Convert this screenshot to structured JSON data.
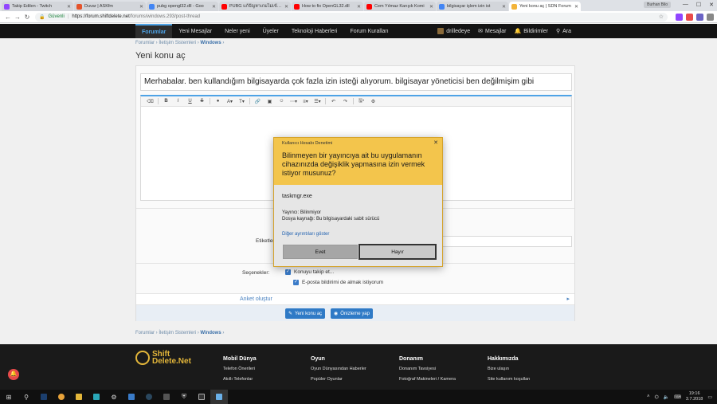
{
  "browser": {
    "tabs": [
      {
        "title": "Takip Edilen - Twitch",
        "color": "#9146ff",
        "active": false
      },
      {
        "title": "Duvar | ASKfm",
        "color": "#e5532b",
        "active": false
      },
      {
        "title": "pubg opengl32.dll - Goo",
        "color": "#4285f4",
        "active": false
      },
      {
        "title": "PUBG แก้ปัญหาเกมไม่เข้าข้อมูล",
        "color": "#ff0000",
        "active": false
      },
      {
        "title": "How to fix OpenGL32.dll",
        "color": "#ff0000",
        "active": false
      },
      {
        "title": "Cem Yılmaz Karışık Komi",
        "color": "#ff0000",
        "active": false
      },
      {
        "title": "bilgisayar işlem izin ist",
        "color": "#4285f4",
        "active": false
      },
      {
        "title": "Yeni konu aç | SDN Forum",
        "color": "#f3b43a",
        "active": true
      }
    ],
    "profile": "Burhan Bilo",
    "secure_label": "Güvenli",
    "url_host": "https://forum.shiftdelete.net",
    "url_path": "/forums/windows.293/post-thread"
  },
  "sitenav": {
    "items": [
      "Forumlar",
      "Yeni Mesajlar",
      "Neler yeni",
      "Üyeler",
      "Teknoloji Haberleri",
      "Forum Kuralları"
    ],
    "user": "drilledeye",
    "messages": "Mesajlar",
    "alerts": "Bildirimler",
    "search": "Ara"
  },
  "breadcrumb": [
    "Forumlar",
    "İletişim Sistemleri",
    "Windows"
  ],
  "page_title": "Yeni konu aç",
  "form": {
    "title_value": "Merhabalar. ben kullandığım bilgisayarda çok fazla izin isteği alıyorum. bilgisayar yöneticisi ben değilmişim gibi",
    "tags_label": "Etiketler",
    "options_label": "Seçenekler:",
    "watch_label": "Konuyu takip et...",
    "email_label": "E-posta bildirimi de almak istiyorum",
    "poll_label": "Anket oluştur",
    "submit_label": "Yeni konu aç",
    "preview_label": "Önizleme yap"
  },
  "footer": {
    "logo_line1": "Shift",
    "logo_line2": "Delete.Net",
    "columns": [
      {
        "heading": "Mobil Dünya",
        "items": [
          "Telefon Önerileri",
          "Akıllı Telefonlar"
        ]
      },
      {
        "heading": "Oyun",
        "items": [
          "Oyun Dünyasından Haberler",
          "Popüler Oyunlar"
        ]
      },
      {
        "heading": "Donanım",
        "items": [
          "Donanım Tavsiyesi",
          "Fotoğraf Makineleri / Kamera"
        ]
      },
      {
        "heading": "Hakkımızda",
        "items": [
          "Bize ulaşın",
          "Site kullanım koşulları"
        ]
      }
    ]
  },
  "uac": {
    "caption": "Kullanıcı Hesabı Denetimi",
    "question": "Bilinmeyen bir yayıncıya ait bu uygulamanın cihazınızda değişiklik yapmasına izin vermek istiyor musunuz?",
    "app_name": "taskmgr.exe",
    "publisher": "Yayıncı: Bilinmiyor",
    "origin": "Dosya kaynağı: Bu bilgisayardaki sabit sürücü",
    "more_details": "Diğer ayrıntıları göster",
    "yes": "Evet",
    "no": "Hayır"
  },
  "taskbar": {
    "time": "19:16",
    "date": "3.7.2018"
  }
}
